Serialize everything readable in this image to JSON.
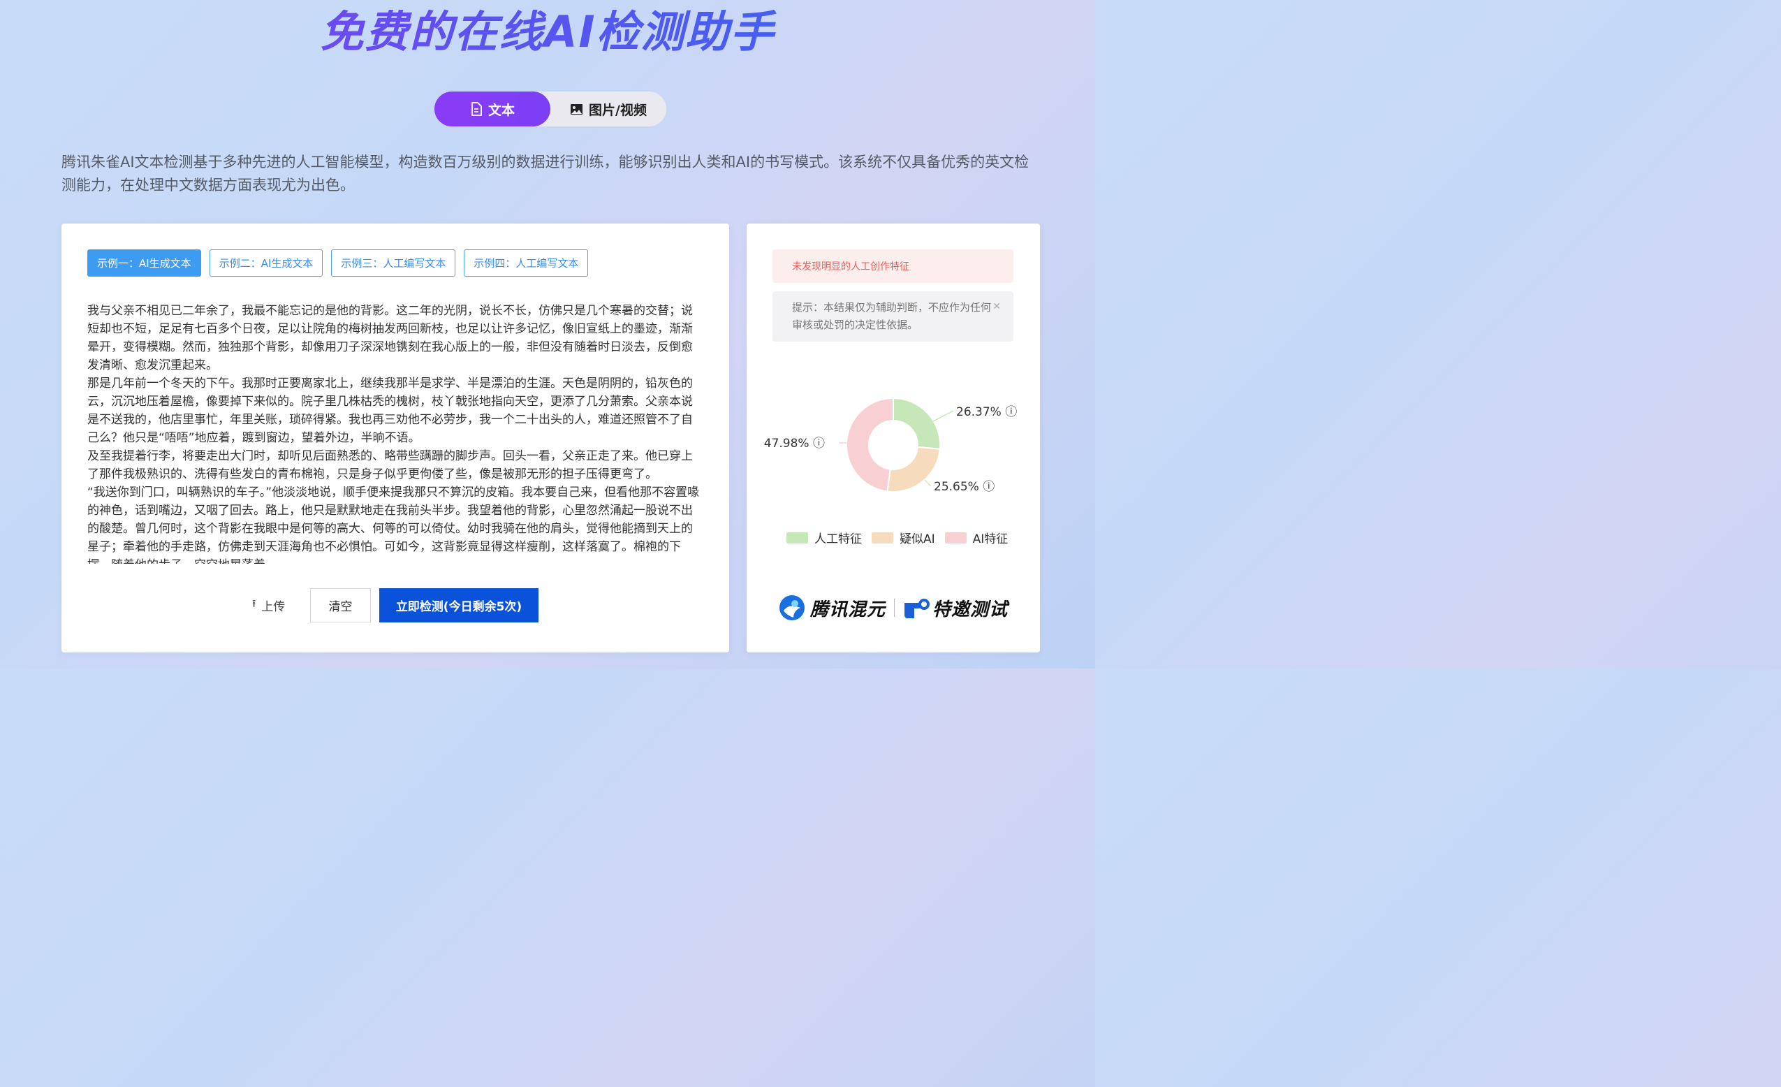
{
  "header": {
    "title": "免费的在线AI检测助手"
  },
  "tabs": [
    {
      "label": "文本",
      "icon": "document-icon",
      "active": true
    },
    {
      "label": "图片/视频",
      "icon": "image-icon",
      "active": false
    }
  ],
  "description": "腾讯朱雀AI文本检测基于多种先进的人工智能模型，构造数百万级别的数据进行训练，能够识别出人类和AI的书写模式。该系统不仅具备优秀的英文检测能力，在处理中文数据方面表现尤为出色。",
  "examples": [
    {
      "label": "示例一：AI生成文本",
      "active": true
    },
    {
      "label": "示例二：AI生成文本",
      "active": false
    },
    {
      "label": "示例三：人工编写文本",
      "active": false
    },
    {
      "label": "示例四：人工编写文本",
      "active": false
    }
  ],
  "input_text": {
    "paragraphs": [
      "我与父亲不相见已二年余了，我最不能忘记的是他的背影。这二年的光阴，说长不长，仿佛只是几个寒暑的交替；说短却也不短，足足有七百多个日夜，足以让院角的梅树抽发两回新枝，也足以让许多记忆，像旧宣纸上的墨迹，渐渐晕开，变得模糊。然而，独独那个背影，却像用刀子深深地镌刻在我心版上的一般，非但没有随着时日淡去，反倒愈发清晰、愈发沉重起来。",
      "那是几年前一个冬天的下午。我那时正要离家北上，继续我那半是求学、半是漂泊的生涯。天色是阴阴的，铅灰色的云，沉沉地压着屋檐，像要掉下来似的。院子里几株枯秃的槐树，枝丫戟张地指向天空，更添了几分萧索。父亲本说是不送我的，他店里事忙，年里关账，琐碎得紧。我也再三劝他不必劳步，我一个二十出头的人，难道还照管不了自己么？他只是“唔唔”地应着，踱到窗边，望着外边，半晌不语。",
      "及至我提着行李，将要走出大门时，却听见后面熟悉的、略带些蹒跚的脚步声。回头一看，父亲正走了来。他已穿上了那件我极熟识的、洗得有些发白的青布棉袍，只是身子似乎更佝偻了些，像是被那无形的担子压得更弯了。",
      "“我送你到门口，叫辆熟识的车子。”他淡淡地说，顺手便来提我那只不算沉的皮箱。我本要自己来，但看他那不容置喙的神色，话到嘴边，又咽了回去。路上，他只是默默地走在我前头半步。我望着他的背影，心里忽然涌起一股说不出的酸楚。曾几何时，这个背影在我眼中是何等的高大、何等的可以倚仗。幼时我骑在他的肩头，觉得他能摘到天上的星子；牵着他的手走路，仿佛走到天涯海角也不必惧怕。可如今，这背影竟显得这样瘦削，这样落寞了。棉袍的下摆，随着他的步子，空空地晃荡着。"
    ]
  },
  "actions": {
    "upload": "上传",
    "clear": "清空",
    "detect": "立即检测(今日剩余5次)"
  },
  "result": {
    "alert": "未发现明显的人工创作特征",
    "tip": "提示：本结果仅为辅助判断，不应作为任何审核或处罚的决定性依据。",
    "close_icon": "close-icon"
  },
  "chart_data": {
    "type": "pie",
    "donut": true,
    "slices": [
      {
        "name": "人工特征",
        "value": 26.37,
        "label": "26.37%",
        "color": "#c6e8b8"
      },
      {
        "name": "疑似AI",
        "value": 25.65,
        "label": "25.65%",
        "color": "#f6dcbc"
      },
      {
        "name": "AI特征",
        "value": 47.98,
        "label": "47.98%",
        "color": "#f8cfd2"
      }
    ],
    "legend_position": "bottom",
    "info_icon": "info-icon"
  },
  "branding": {
    "left": "腾讯混元",
    "right": "特邀测试"
  },
  "colors": {
    "accent_purple": "#8a3cf5",
    "primary_blue": "#0a52d9",
    "example_blue": "#3e9bf2",
    "alert_red": "#e8605a"
  }
}
